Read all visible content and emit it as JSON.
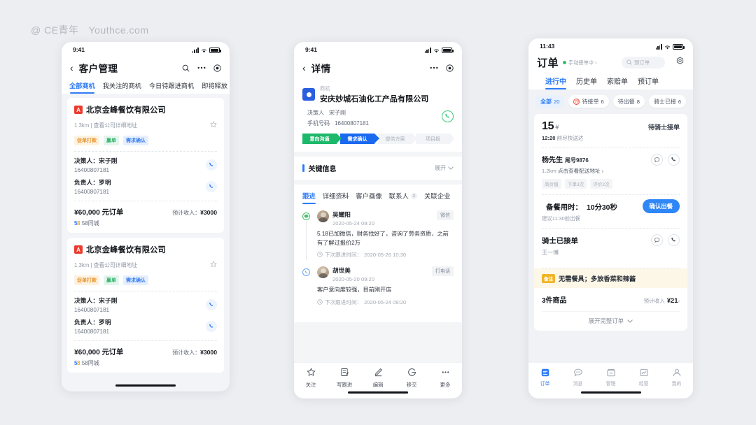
{
  "watermark": {
    "handle": "@ CE青年",
    "site": "Youthce.com"
  },
  "screen1": {
    "status": {
      "time": "9:41"
    },
    "nav": {
      "back": "‹",
      "title": "客户管理",
      "search_icon": "search-icon",
      "more_icon": "more-icon",
      "target_icon": "target-icon"
    },
    "tabs": [
      {
        "label": "全部商机",
        "active": true
      },
      {
        "label": "我关注的商机",
        "active": false
      },
      {
        "label": "今日待跟进商机",
        "active": false
      },
      {
        "label": "即将释放",
        "active": false
      }
    ],
    "cards": [
      {
        "avatar_letter": "A",
        "company": "北京金峰餐饮有限公司",
        "distance_line": "1.3km | 查看公司详细地址",
        "tags": [
          "促单打款",
          "赢单",
          "需求确认"
        ],
        "contacts": [
          {
            "role": "决策人：宋子刚",
            "phone": "16400807181"
          },
          {
            "role": "负责人：罗明",
            "phone": "16400807181"
          }
        ],
        "amount": "¥60,000 元订单",
        "income_label": "预计收入：",
        "income_value": "¥3000",
        "source_logo": "58",
        "source_name": "58同城"
      },
      {
        "avatar_letter": "A",
        "company": "北京金峰餐饮有限公司",
        "distance_line": "1.3km | 查看公司详细地址",
        "tags": [
          "促单打款",
          "赢单",
          "需求确认"
        ],
        "contacts": [
          {
            "role": "决策人：宋子刚",
            "phone": "16400807181"
          },
          {
            "role": "负责人：罗明",
            "phone": "16400807181"
          }
        ],
        "amount": "¥60,000 元订单",
        "income_label": "预计收入：",
        "income_value": "¥3000",
        "source_logo": "58",
        "source_name": "58同城"
      }
    ]
  },
  "screen2": {
    "status": {
      "time": "9:41"
    },
    "nav": {
      "back": "‹",
      "title": "详情",
      "more_icon": "more-icon",
      "target_icon": "target-icon"
    },
    "company": {
      "kind": "商机",
      "name": "安庆妙城石油化工产品有限公司",
      "decision_label": "决策人",
      "decision_value": "宋子刚",
      "phone_label": "手机号码",
      "phone_value": "16400807181",
      "call_icon": "phone-icon"
    },
    "stepper": [
      {
        "label": "意向沟通",
        "state": "green"
      },
      {
        "label": "需求确认",
        "state": "blue"
      },
      {
        "label": "提供方案",
        "state": "gray"
      },
      {
        "label": "项目报",
        "state": "gray"
      }
    ],
    "keyinfo": {
      "title": "关键信息",
      "expand": "展开"
    },
    "tabs": [
      {
        "label": "跟进",
        "active": true,
        "count": null
      },
      {
        "label": "详细资料",
        "active": false,
        "count": null
      },
      {
        "label": "客户画像",
        "active": false,
        "count": null
      },
      {
        "label": "联系人",
        "active": false,
        "count": "2"
      },
      {
        "label": "关联企业",
        "active": false,
        "count": null
      }
    ],
    "feed": [
      {
        "channel_icon": "wechat-icon",
        "name": "吴耀阳",
        "time": "2020-05-24 09:20",
        "chip": "微信",
        "text": "5.18已加微信，财务找好了，咨询了劳务资质，之前有了解过报价2万",
        "next_label": "下次跟进时间：",
        "next_time": "2020-05-26 10:30"
      },
      {
        "channel_icon": "phone-icon",
        "name": "胡世美",
        "time": "2020-05-20 09:20",
        "chip": "打电话",
        "text": "客户意向度较强，目前刚开店",
        "next_label": "下次跟进时间：",
        "next_time": "2020-05-24 09:20"
      }
    ],
    "bottombar": [
      {
        "icon": "star-icon",
        "label": "关注"
      },
      {
        "icon": "note-icon",
        "label": "写跟进"
      },
      {
        "icon": "pencil-icon",
        "label": "编辑"
      },
      {
        "icon": "transfer-icon",
        "label": "移交"
      },
      {
        "icon": "ellipsis-icon",
        "label": "更多"
      }
    ]
  },
  "screen3": {
    "status": {
      "time": "11:43"
    },
    "header": {
      "title": "订单",
      "mode_pill": "手动接单中 ›",
      "search_placeholder": "预订单",
      "search_icon": "search-icon",
      "gear_icon": "gear-icon"
    },
    "tabs": [
      {
        "label": "进行中",
        "active": true
      },
      {
        "label": "历史单",
        "active": false
      },
      {
        "label": "索赔单",
        "active": false
      },
      {
        "label": "预订单",
        "active": false
      }
    ],
    "chips": [
      {
        "label": "全部",
        "count": "20",
        "active": true,
        "icon": null
      },
      {
        "label": "待接单",
        "count": "6",
        "active": false,
        "icon": "alarm-icon"
      },
      {
        "label": "待出餐",
        "count": "8",
        "active": false,
        "icon": null
      },
      {
        "label": "骑士已接",
        "count": "6",
        "active": false,
        "icon": null
      }
    ],
    "order": {
      "number": "15",
      "hash": "#",
      "status": "待骑士接单",
      "eta_bold": "12:20",
      "eta_rest": " 前尽快送达",
      "customer_name": "杨先生",
      "customer_tail": "尾号9876",
      "address_distance": "1.2km",
      "address_text": "点击查看配送地址 ›",
      "mini_tags": [
        "高价值",
        "下单3次",
        "评价2次"
      ],
      "chat_icon": "chat-icon",
      "call_icon": "phone-icon",
      "prep_label": "备餐用时：",
      "prep_value": "10分30秒",
      "prep_sub": "建议11:30前出餐",
      "prep_button": "确认出餐",
      "rider_title": "骑士已接单",
      "rider_name": "王一博",
      "note_badge": "备注",
      "note_text": "无需餐具；多放香菜和辣酱",
      "goods_count": "3件商品",
      "goods_income_label": "预计收入",
      "goods_income_value": "¥21",
      "goods_income_arrow": "›",
      "expand": "展开完整订单"
    },
    "nav": [
      {
        "icon": "orders-icon",
        "label": "订单",
        "active": true
      },
      {
        "icon": "message-icon",
        "label": "消息",
        "active": false
      },
      {
        "icon": "store-icon",
        "label": "管理",
        "active": false
      },
      {
        "icon": "chart-icon",
        "label": "经营",
        "active": false
      },
      {
        "icon": "user-icon",
        "label": "我的",
        "active": false
      }
    ]
  }
}
